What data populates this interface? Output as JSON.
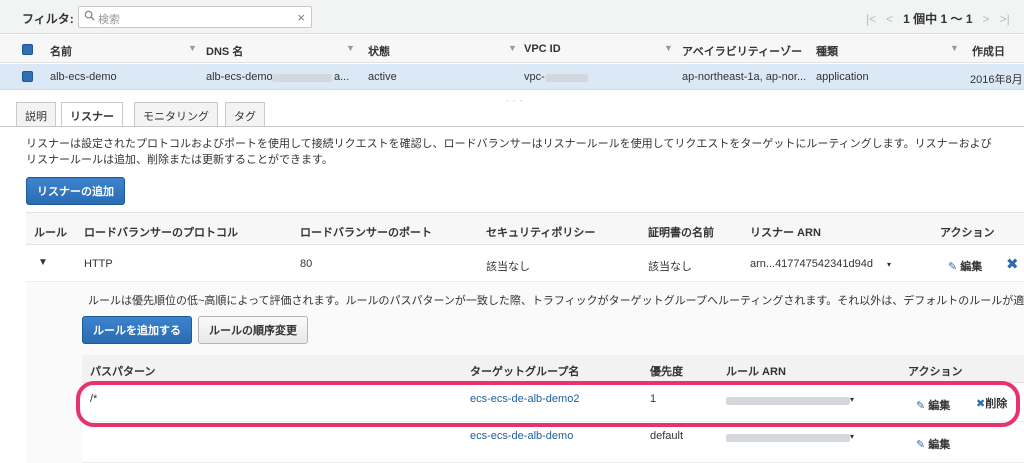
{
  "filter": {
    "label": "フィルタ:",
    "placeholder": "検索",
    "clear": "×"
  },
  "pager": {
    "first": "|<",
    "prev": "<",
    "text": "1 個中 1 ～ 1",
    "next": ">",
    "last": ">|"
  },
  "list": {
    "columns": [
      "名前",
      "DNS 名",
      "状態",
      "VPC ID",
      "アベイラビリティーゾー",
      "種類",
      "作成日"
    ],
    "row": {
      "name": "alb-ecs-demo",
      "dns_prefix": "alb-ecs-demo-",
      "dns_suffix": "a...",
      "state": "active",
      "vpc_prefix": "vpc-",
      "az": "ap-northeast-1a, ap-nor...",
      "type": "application",
      "created": "2016年8月"
    },
    "handle": "- - -"
  },
  "tabs": [
    "説明",
    "リスナー",
    "モニタリング",
    "タグ"
  ],
  "active_tab": "リスナー",
  "listener_desc_1": "リスナーは設定されたプロトコルおよびポートを使用して接続リクエストを確認し、ロードバランサーはリスナールールを使用してリクエストをターゲットにルーティングします。リスナーおよび",
  "listener_desc_2": "リスナールールは追加、削除または更新することができます。",
  "add_listener_button": "リスナーの追加",
  "listener_table": {
    "headers": [
      "ルール",
      "ロードバランサーのプロトコル",
      "ロードバランサーのポート",
      "セキュリティポリシー",
      "証明書の名前",
      "リスナー ARN",
      "アクション"
    ],
    "row": {
      "protocol": "HTTP",
      "port": "80",
      "policy": "該当なし",
      "cert": "該当なし",
      "arn": "arn...417747542341d94d",
      "edit": "編集"
    }
  },
  "rules_desc": "ルールは優先順位の低~高順によって評価されます。ルールのパスパターンが一致した際、トラフィックがターゲットグループへルーティングされます。それ以外は、デフォルトのルールが適",
  "add_rule_button": "ルールを追加する",
  "reorder_button": "ルールの順序変更",
  "rules_table": {
    "headers": [
      "パスパターン",
      "ターゲットグループ名",
      "優先度",
      "ルール ARN",
      "アクション"
    ],
    "rows": [
      {
        "path": "/*",
        "target": "ecs-ecs-de-alb-demo2",
        "priority": "1",
        "edit": "編集",
        "delete": "削除"
      },
      {
        "path": "",
        "target": "ecs-ecs-de-alb-demo",
        "priority": "default",
        "edit": "編集"
      }
    ]
  },
  "colors": {
    "accent": "#2a6cb3",
    "highlight": "#e8326e",
    "link": "#1f5f9e"
  },
  "icons": [
    "search-icon",
    "clear-icon",
    "sort-icon",
    "expand-icon",
    "pencil-icon",
    "close-icon",
    "dropdown-icon"
  ]
}
